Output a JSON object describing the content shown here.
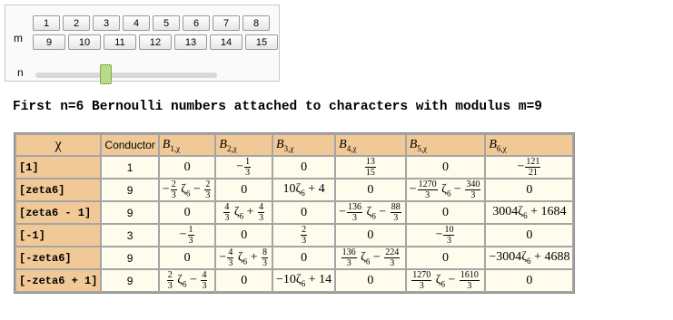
{
  "controls": {
    "m_label": "m",
    "n_label": "n",
    "m_buttons_row1": [
      "1",
      "2",
      "3",
      "4",
      "5",
      "6",
      "7",
      "8"
    ],
    "m_buttons_row2": [
      "9",
      "10",
      "11",
      "12",
      "13",
      "14",
      "15"
    ],
    "n_slider": {
      "value": 6,
      "max": 15
    }
  },
  "heading": "First n=6 Bernoulli numbers attached to characters with modulus m=9",
  "table": {
    "headers": [
      "χ",
      "Conductor",
      "B1,χ",
      "B2,χ",
      "B3,χ",
      "B4,χ",
      "B5,χ",
      "B6,χ"
    ],
    "rows": [
      {
        "chi": "[1]",
        "conductor": "1",
        "b": [
          "0",
          "−1/3",
          "0",
          "13/15",
          "0",
          "−121/21"
        ]
      },
      {
        "chi": "[zeta6]",
        "conductor": "9",
        "b": [
          "−2/3 ζ6 − 2/3",
          "0",
          "10ζ6 + 4",
          "0",
          "−1270/3 ζ6 − 340/3",
          "0"
        ]
      },
      {
        "chi": "[zeta6 - 1]",
        "conductor": "9",
        "b": [
          "0",
          "4/3 ζ6 + 4/3",
          "0",
          "−136/3 ζ6 − 88/3",
          "0",
          "3004ζ6 + 1684"
        ]
      },
      {
        "chi": "[-1]",
        "conductor": "3",
        "b": [
          "−1/3",
          "0",
          "2/3",
          "0",
          "−10/3",
          "0"
        ]
      },
      {
        "chi": "[-zeta6]",
        "conductor": "9",
        "b": [
          "0",
          "−4/3 ζ6 + 8/3",
          "0",
          "136/3 ζ6 − 224/3",
          "0",
          "−3004ζ6 + 4688"
        ]
      },
      {
        "chi": "[-zeta6 + 1]",
        "conductor": "9",
        "b": [
          "2/3 ζ6 − 4/3",
          "0",
          "−10ζ6 + 14",
          "0",
          "1270/3 ζ6 − 1610/3",
          "0"
        ]
      }
    ]
  }
}
